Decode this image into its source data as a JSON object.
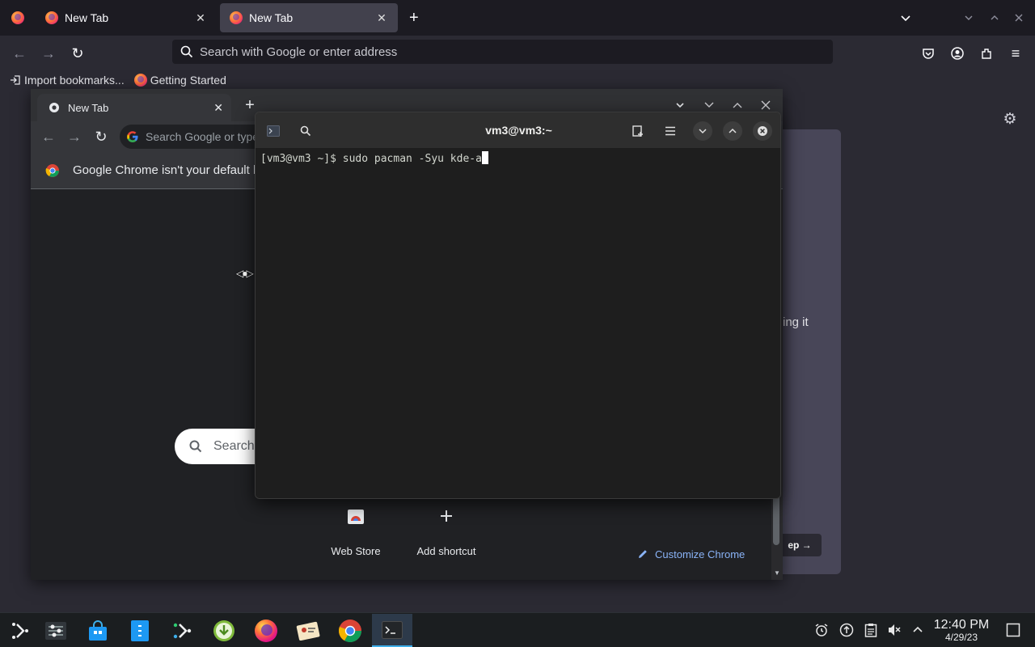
{
  "firefox": {
    "tabs": [
      {
        "label": "New Tab",
        "active": false
      },
      {
        "label": "New Tab",
        "active": true
      }
    ],
    "url_placeholder": "Search with Google or enter address",
    "bookmarks": [
      {
        "label": "Import bookmarks...",
        "icon": "import-icon"
      },
      {
        "label": "Getting Started",
        "icon": "firefox-icon"
      }
    ],
    "background_panel": {
      "partial_text": "ing it",
      "partial_button": "ep →"
    }
  },
  "chrome": {
    "tab_title": "New Tab",
    "omnibox_placeholder": "Search Google or type a URL",
    "infobar_text": "Google Chrome isn't your default browser",
    "search_box_label": "Search Google or type a URL",
    "shortcuts": [
      {
        "label": "Web Store",
        "icon": "web-store-icon"
      },
      {
        "label": "Add shortcut",
        "icon": "plus-icon"
      }
    ],
    "customize_label": "Customize Chrome"
  },
  "terminal": {
    "title": "vm3@vm3:~",
    "prompt": "[vm3@vm3 ~]$ ",
    "command": "sudo pacman -Syu kde-a"
  },
  "taskbar": {
    "apps": [
      {
        "name": "application-launcher",
        "active": false
      },
      {
        "name": "system-settings",
        "active": false
      },
      {
        "name": "discover-store",
        "active": false
      },
      {
        "name": "file-manager",
        "active": false
      },
      {
        "name": "kdeconnect",
        "active": false
      },
      {
        "name": "downloader",
        "active": false
      },
      {
        "name": "firefox",
        "active": false
      },
      {
        "name": "contacts",
        "active": false
      },
      {
        "name": "chrome",
        "active": false
      },
      {
        "name": "terminal",
        "active": true
      }
    ],
    "clock_time": "12:40 PM",
    "clock_date": "4/29/23"
  },
  "colors": {
    "accent": "#3daee9",
    "firefox_bg": "#2b2a33",
    "chrome_link": "#8ab4f8"
  }
}
